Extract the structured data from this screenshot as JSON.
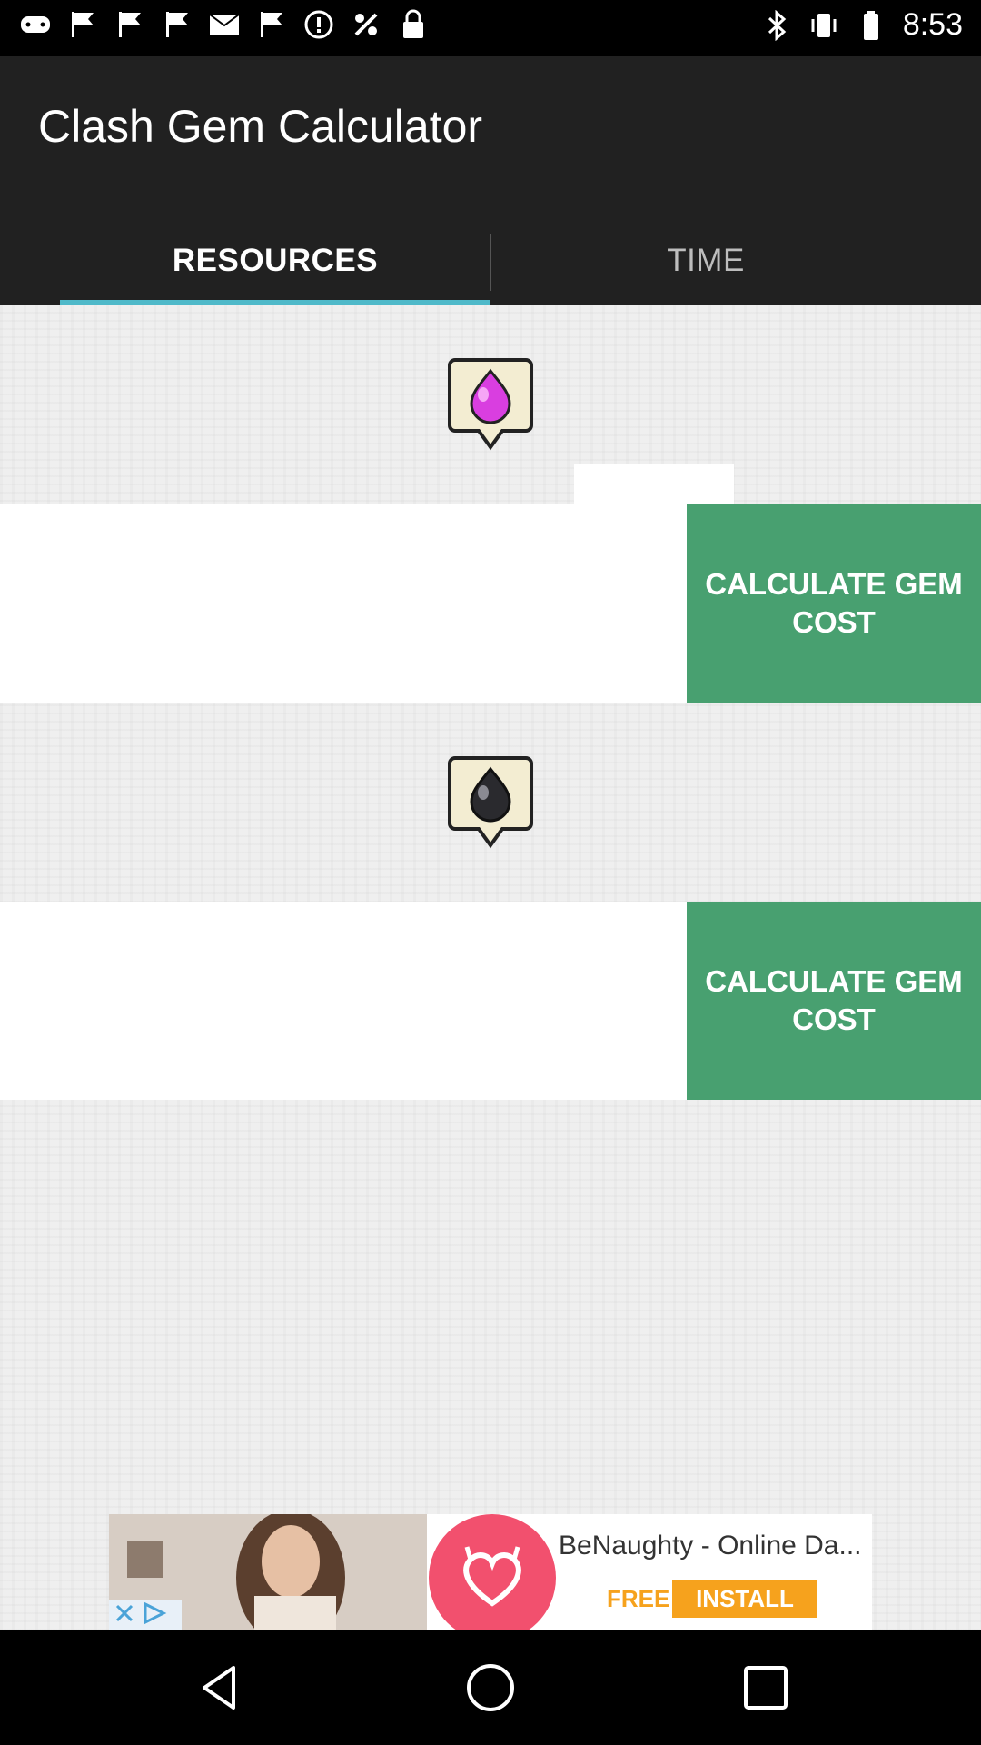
{
  "status_bar": {
    "time": "8:53",
    "left_icons": [
      "gamepad-icon",
      "flag-icon",
      "flag-icon",
      "flag-icon",
      "mail-icon",
      "flag-icon",
      "info-icon",
      "fake-gps-icon",
      "lock-icon"
    ],
    "right_icons": [
      "bluetooth-icon",
      "vibrate-icon",
      "battery-icon"
    ]
  },
  "app_bar": {
    "title": "Clash Gem Calculator",
    "tabs": [
      {
        "label": "RESOURCES",
        "selected": true
      },
      {
        "label": "TIME",
        "selected": false
      }
    ],
    "background_color": "#212121",
    "indicator_color": "#4fb9c9"
  },
  "sections": [
    {
      "icon": "elixir-drop-icon",
      "button_label": "CALCULATE GEM COST",
      "input_value": ""
    },
    {
      "icon": "dark-elixir-drop-icon",
      "button_label": "CALCULATE GEM COST",
      "input_value": ""
    }
  ],
  "button_color": "#48a070",
  "ad": {
    "title": "BeNaughty - Online Da...",
    "free_label": "FREE",
    "install_label": "INSTALL"
  },
  "nav_bar": {
    "buttons": [
      "back-icon",
      "home-icon",
      "recents-icon"
    ]
  }
}
